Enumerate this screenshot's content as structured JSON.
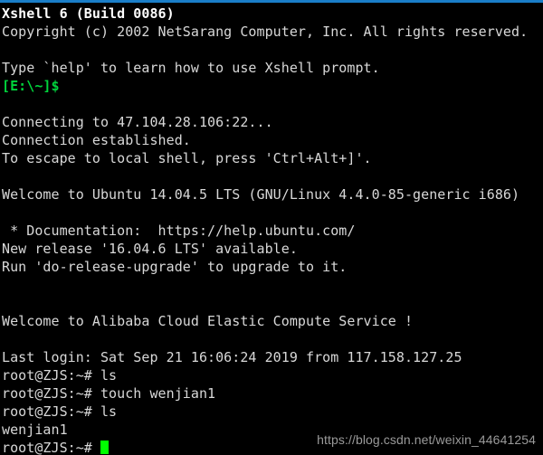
{
  "window": {
    "app_title": "Xshell 6 (Build 0086)",
    "accent_color": "#1a7ec8",
    "background_color": "#000000",
    "text_color": "#d8d8d8",
    "prompt_color": "#00d43c",
    "cursor_color": "#00ff00"
  },
  "terminal": {
    "lines": [
      {
        "text": "Xshell 6 (Build 0086)",
        "style": "bold"
      },
      {
        "text": "Copyright (c) 2002 NetSarang Computer, Inc. All rights reserved.",
        "style": "normal"
      },
      {
        "text": "",
        "style": "blank"
      },
      {
        "text": "Type `help' to learn how to use Xshell prompt.",
        "style": "normal"
      },
      {
        "text": "[E:\\~]$",
        "style": "prompt-green"
      },
      {
        "text": "",
        "style": "blank"
      },
      {
        "text": "Connecting to 47.104.28.106:22...",
        "style": "normal"
      },
      {
        "text": "Connection established.",
        "style": "normal"
      },
      {
        "text": "To escape to local shell, press 'Ctrl+Alt+]'.",
        "style": "normal"
      },
      {
        "text": "",
        "style": "blank"
      },
      {
        "text": "Welcome to Ubuntu 14.04.5 LTS (GNU/Linux 4.4.0-85-generic i686)",
        "style": "normal"
      },
      {
        "text": "",
        "style": "blank"
      },
      {
        "text": " * Documentation:  https://help.ubuntu.com/",
        "style": "normal"
      },
      {
        "text": "New release '16.04.6 LTS' available.",
        "style": "normal"
      },
      {
        "text": "Run 'do-release-upgrade' to upgrade to it.",
        "style": "normal"
      },
      {
        "text": "",
        "style": "blank"
      },
      {
        "text": "",
        "style": "blank"
      },
      {
        "text": "Welcome to Alibaba Cloud Elastic Compute Service !",
        "style": "normal"
      },
      {
        "text": "",
        "style": "blank"
      },
      {
        "text": "Last login: Sat Sep 21 16:06:24 2019 from 117.158.127.25",
        "style": "normal"
      },
      {
        "text": "root@ZJS:~# ls",
        "style": "normal"
      },
      {
        "text": "root@ZJS:~# touch wenjian1",
        "style": "normal"
      },
      {
        "text": "root@ZJS:~# ls",
        "style": "normal"
      },
      {
        "text": "wenjian1",
        "style": "normal"
      },
      {
        "text": "root@ZJS:~# ",
        "style": "cursor-line"
      }
    ]
  },
  "watermark": {
    "text": "https://blog.csdn.net/weixin_44641254"
  }
}
